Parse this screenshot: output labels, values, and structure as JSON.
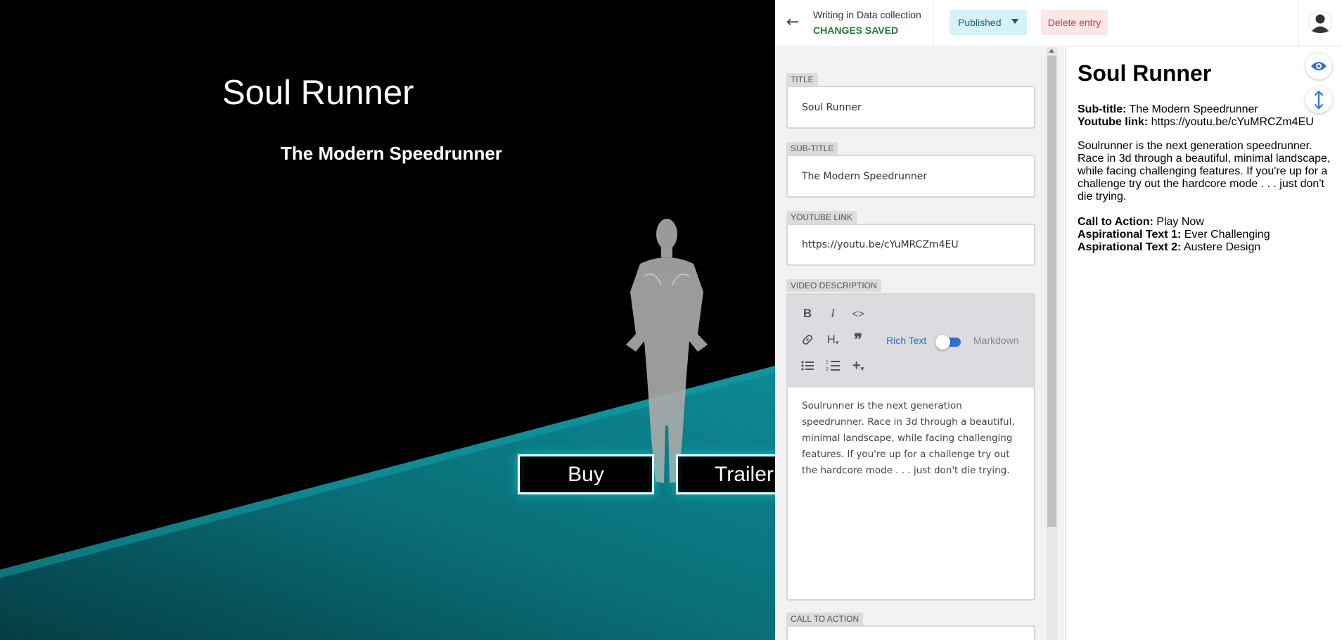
{
  "site": {
    "title": "Soul Runner",
    "subtitle": "The Modern Speedrunner",
    "buy_label": "Buy",
    "trailer_label": "Trailer",
    "accent_color": "#0a7c86"
  },
  "topbar": {
    "breadcrumb": "Writing in Data collection",
    "save_status": "CHANGES SAVED",
    "status_label": "Published",
    "delete_label": "Delete entry"
  },
  "fields": {
    "title_label": "TITLE",
    "title_value": "Soul Runner",
    "subtitle_label": "SUB-TITLE",
    "subtitle_value": "The Modern Speedrunner",
    "youtube_label": "YOUTUBE LINK",
    "youtube_value": "https://youtu.be/cYuMRCZm4EU",
    "video_description_label": "VIDEO DESCRIPTION",
    "cta_label": "CALL TO ACTION"
  },
  "editor": {
    "rich_text_label": "Rich Text",
    "markdown_label": "Markdown",
    "body": "Soulrunner is the next generation speedrunner. Race in 3d through a beautiful, minimal landscape, while facing challenging features. If you're up for a challenge try out the hardcore mode . . . just don't die trying."
  },
  "preview": {
    "title": "Soul Runner",
    "subtitle_key": "Sub-title:",
    "subtitle_val": "The Modern Speedrunner",
    "youtube_key": "Youtube link:",
    "youtube_val": "https://youtu.be/cYuMRCZm4EU",
    "description": "Soulrunner is the next generation speedrunner. Race in 3d through a beautiful, minimal landscape, while facing challenging features. If you're up for a challenge try out the hardcore mode . . . just don't die trying.",
    "cta_key": "Call to Action:",
    "cta_val": "Play Now",
    "asp1_key": "Aspirational Text 1:",
    "asp1_val": "Ever Challenging",
    "asp2_key": "Aspirational Text 2:",
    "asp2_val": "Austere Design"
  },
  "icons": {
    "back": "arrow-left-icon",
    "avatar": "user-avatar-icon",
    "preview_toggle": "eye-icon",
    "scroll_sync": "vertical-arrows-icon"
  }
}
